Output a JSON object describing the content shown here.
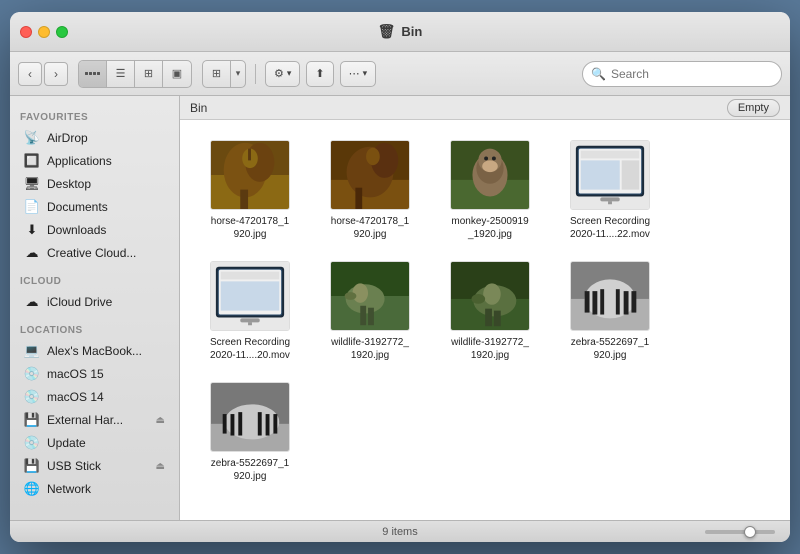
{
  "window": {
    "title": "Bin",
    "title_icon": "🗑"
  },
  "toolbar": {
    "search_placeholder": "Search",
    "action_gear_label": "⚙",
    "action_share_label": "↑",
    "action_list_label": "≡"
  },
  "pathbar": {
    "path": "Bin",
    "empty_button": "Empty"
  },
  "sidebar": {
    "favourites_header": "Favourites",
    "icloud_header": "iCloud",
    "locations_header": "Locations",
    "items_favourites": [
      {
        "id": "airdrop",
        "label": "AirDrop",
        "icon": "📡"
      },
      {
        "id": "applications",
        "label": "Applications",
        "icon": "🔲"
      },
      {
        "id": "desktop",
        "label": "Desktop",
        "icon": "🖥"
      },
      {
        "id": "documents",
        "label": "Documents",
        "icon": "📄"
      },
      {
        "id": "downloads",
        "label": "Downloads",
        "icon": "⬇"
      },
      {
        "id": "creative-cloud",
        "label": "Creative Cloud...",
        "icon": "☁"
      }
    ],
    "items_icloud": [
      {
        "id": "icloud-drive",
        "label": "iCloud Drive",
        "icon": "☁"
      }
    ],
    "items_locations": [
      {
        "id": "macbook",
        "label": "Alex's MacBook...",
        "icon": "💻"
      },
      {
        "id": "macos15",
        "label": "macOS 15",
        "icon": "💿"
      },
      {
        "id": "macos14",
        "label": "macOS 14",
        "icon": "💿"
      },
      {
        "id": "external-hd",
        "label": "External Har...",
        "icon": "💾",
        "eject": true
      },
      {
        "id": "update",
        "label": "Update",
        "icon": "💿"
      },
      {
        "id": "usb-stick",
        "label": "USB Stick",
        "icon": "💾",
        "eject": true
      },
      {
        "id": "network",
        "label": "Network",
        "icon": "🌐"
      }
    ]
  },
  "files": {
    "items": [
      {
        "id": "horse1",
        "label": "horse-4720178_1920.jpg",
        "type": "image",
        "color1": "#8B5E3C",
        "color2": "#6B4423"
      },
      {
        "id": "horse2",
        "label": "horse-4720178_1920.jpg",
        "type": "image",
        "color1": "#7B4E2C",
        "color2": "#5B3413"
      },
      {
        "id": "monkey",
        "label": "monkey-2500919_1920.jpg",
        "type": "image",
        "color1": "#5B7A3C",
        "color2": "#4A6230"
      },
      {
        "id": "screen1",
        "label": "Screen Recording 2020-11....22.mov",
        "type": "screen",
        "color1": "#1a3a5c",
        "color2": "#2a4a6c"
      },
      {
        "id": "screen2",
        "label": "Screen Recording 2020-11....20.mov",
        "type": "screen",
        "color1": "#1a3a5c",
        "color2": "#2a4a6c"
      },
      {
        "id": "wildlife1",
        "label": "wildlife-3192772_1920.jpg",
        "type": "image",
        "color1": "#3a5a2a",
        "color2": "#556b2f"
      },
      {
        "id": "wildlife2",
        "label": "wildlife-3192772_1920.jpg",
        "type": "image",
        "color1": "#3a5a2a",
        "color2": "#445522"
      },
      {
        "id": "zebra1",
        "label": "zebra-5522697_1920.jpg",
        "type": "image",
        "color1": "#c0c0c0",
        "color2": "#404040"
      },
      {
        "id": "zebra2",
        "label": "zebra-5522697_1920.jpg",
        "type": "image",
        "color1": "#b8b8b8",
        "color2": "#383838"
      }
    ],
    "count_label": "9 items"
  }
}
